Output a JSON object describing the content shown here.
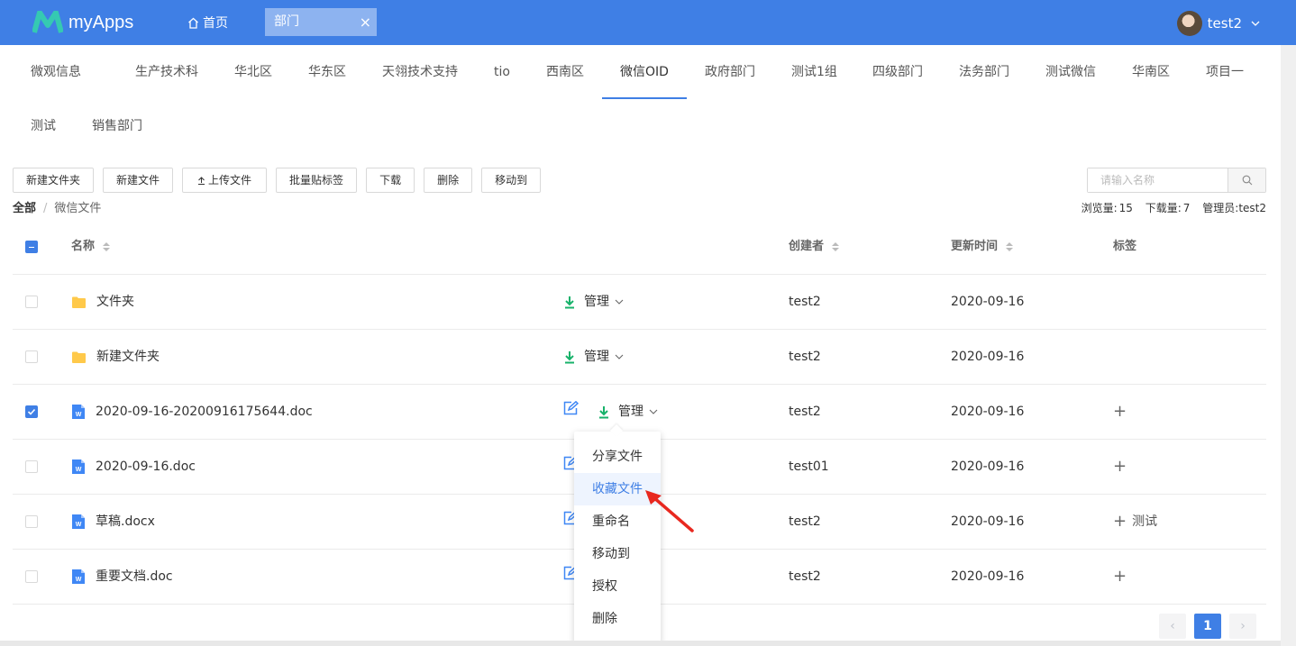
{
  "topbar": {
    "app_name": "myApps",
    "home_label": "首页",
    "open_tab_label": "部门",
    "close_glyph": "×",
    "user_name": "test2",
    "brand_color": "#3f7fe5"
  },
  "departments": {
    "row1": [
      "微观信息",
      "生产技术科",
      "华北区",
      "华东区",
      "天翎技术支持",
      "tio",
      "西南区",
      "微信OID",
      "政府部门",
      "测试1组",
      "四级部门",
      "法务部门",
      "测试微信",
      "华南区",
      "项目一"
    ],
    "row2": [
      "测试",
      "销售部门"
    ],
    "active": "微信OID"
  },
  "toolbar": {
    "new_folder": "新建文件夹",
    "new_file": "新建文件",
    "upload": "上传文件",
    "batch_tag": "批量贴标签",
    "download": "下载",
    "delete": "删除",
    "move_to": "移动到"
  },
  "search": {
    "placeholder": "请输入名称"
  },
  "breadcrumb": {
    "root": "全部",
    "sep": "/",
    "current": "微信文件"
  },
  "stats": {
    "views_label": "浏览量:",
    "views": "15",
    "downloads_label": "下载量:",
    "downloads": "7",
    "admin_label": "管理员:",
    "admin": "test2"
  },
  "table": {
    "columns": {
      "name": "名称",
      "creator": "创建者",
      "updated": "更新时间",
      "tags": "标签"
    },
    "manage_label": "管理",
    "rows": [
      {
        "type": "folder",
        "name": "文件夹",
        "creator": "test2",
        "updated": "2020-09-16",
        "tag": "",
        "checked": false
      },
      {
        "type": "folder",
        "name": "新建文件夹",
        "creator": "test2",
        "updated": "2020-09-16",
        "tag": "",
        "checked": false
      },
      {
        "type": "doc",
        "name": "2020-09-16-20200916175644.doc",
        "creator": "test2",
        "updated": "2020-09-16",
        "tag": "",
        "checked": true
      },
      {
        "type": "doc",
        "name": "2020-09-16.doc",
        "creator": "test01",
        "updated": "2020-09-16",
        "tag": "",
        "checked": false
      },
      {
        "type": "doc",
        "name": "草稿.docx",
        "creator": "test2",
        "updated": "2020-09-16",
        "tag": "测试",
        "checked": false
      },
      {
        "type": "doc",
        "name": "重要文档.doc",
        "creator": "test2",
        "updated": "2020-09-16",
        "tag": "",
        "checked": false
      }
    ]
  },
  "dropdown": {
    "items": [
      "分享文件",
      "收藏文件",
      "重命名",
      "移动到",
      "授权",
      "删除"
    ],
    "highlighted": "收藏文件"
  },
  "pagination": {
    "prev": "‹",
    "current": "1",
    "next": "›"
  },
  "icons": {
    "home": "home-icon",
    "close": "close-icon",
    "upload": "upload-icon",
    "search": "search-icon",
    "folder": "folder-icon",
    "doc": "word-doc-icon",
    "download": "download-icon",
    "edit": "edit-icon",
    "plus": "plus-icon",
    "chevron": "chevron-down-icon",
    "arrow": "red-arrow-annotation"
  }
}
